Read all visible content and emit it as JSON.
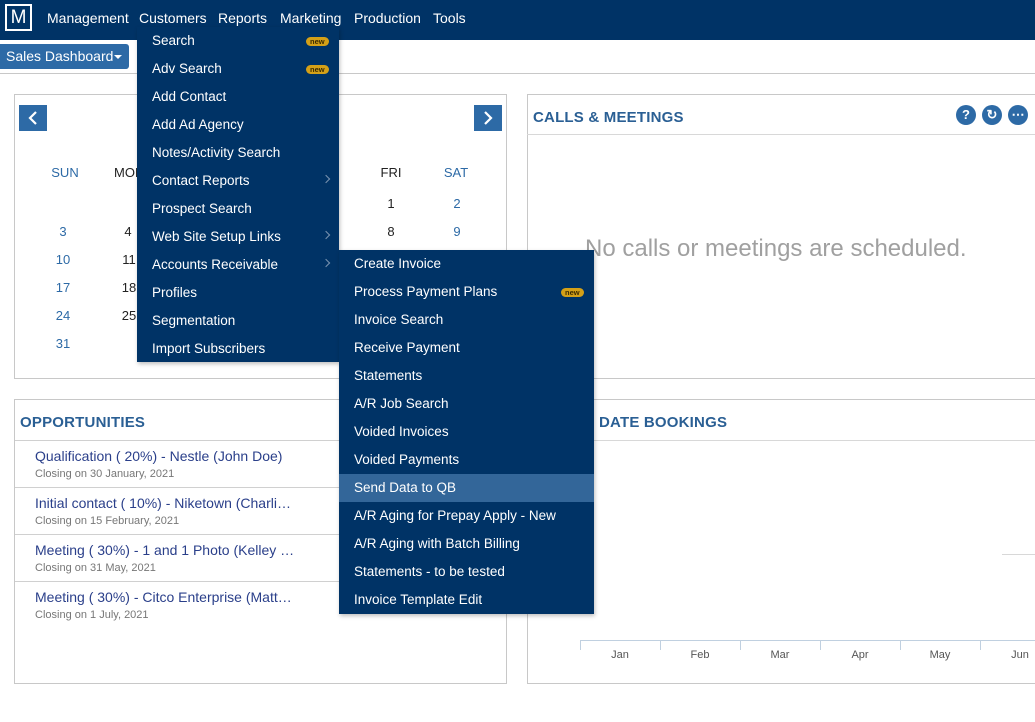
{
  "app": {
    "logo_letter": "M"
  },
  "nav": {
    "items": [
      "Management",
      "Customers",
      "Reports",
      "Marketing",
      "Production",
      "Tools"
    ]
  },
  "dashboard_select": {
    "label": "Sales Dashboard"
  },
  "calendar": {
    "day_headers": [
      "SUN",
      "MON",
      "FRI",
      "SAT"
    ],
    "visible_days": [
      "1",
      "2",
      "3",
      "4",
      "8",
      "9",
      "10",
      "11",
      "17",
      "18",
      "24",
      "25",
      "31"
    ]
  },
  "calls": {
    "title": "CALLS & MEETINGS",
    "buttons": [
      "?",
      "↻",
      "⋯"
    ],
    "empty_message": "No calls or meetings are scheduled."
  },
  "opportunities": {
    "title": "OPPORTUNITIES",
    "items": [
      {
        "title": "Qualification ( 20%) - Nestle (John Doe)",
        "closing": "Closing on 30 January, 2021"
      },
      {
        "title": "Initial contact ( 10%) - Niketown (Charli…",
        "closing": "Closing on 15 February, 2021"
      },
      {
        "title": "Meeting ( 30%) - 1 and 1 Photo (Kelley …",
        "closing": "Closing on 31 May, 2021"
      },
      {
        "title": "Meeting ( 30%) - Citco Enterprise (Matt…",
        "closing": "Closing on 1 July, 2021"
      }
    ]
  },
  "bookings": {
    "title_visible": "DATE BOOKINGS",
    "months": [
      "Jan",
      "Feb",
      "Mar",
      "Apr",
      "May",
      "Jun"
    ]
  },
  "customers_menu": {
    "items": [
      {
        "label": "Search",
        "badge": "new"
      },
      {
        "label": "Adv Search",
        "badge": "new"
      },
      {
        "label": "Add Contact"
      },
      {
        "label": "Add Ad Agency"
      },
      {
        "label": "Notes/Activity Search"
      },
      {
        "label": "Contact Reports",
        "submenu": true
      },
      {
        "label": "Prospect Search"
      },
      {
        "label": "Web Site Setup Links",
        "submenu": true
      },
      {
        "label": "Accounts Receivable",
        "submenu": true
      },
      {
        "label": "Profiles"
      },
      {
        "label": "Segmentation"
      },
      {
        "label": "Import Subscribers"
      }
    ]
  },
  "ar_submenu": {
    "highlighted": "Send Data to QB",
    "items": [
      {
        "label": "Create Invoice"
      },
      {
        "label": "Process Payment Plans",
        "badge": "new"
      },
      {
        "label": "Invoice Search"
      },
      {
        "label": "Receive Payment"
      },
      {
        "label": "Statements"
      },
      {
        "label": "A/R Job Search"
      },
      {
        "label": "Voided Invoices"
      },
      {
        "label": "Voided Payments"
      },
      {
        "label": "Send Data to QB"
      },
      {
        "label": "A/R Aging for Prepay Apply - New"
      },
      {
        "label": "A/R Aging with Batch Billing"
      },
      {
        "label": "Statements - to be tested"
      },
      {
        "label": "Invoice Template Edit"
      }
    ]
  },
  "colors": {
    "nav_bg": "#003366",
    "accent": "#2d6aa6",
    "highlight": "#336699",
    "badge": "#d4a017"
  }
}
